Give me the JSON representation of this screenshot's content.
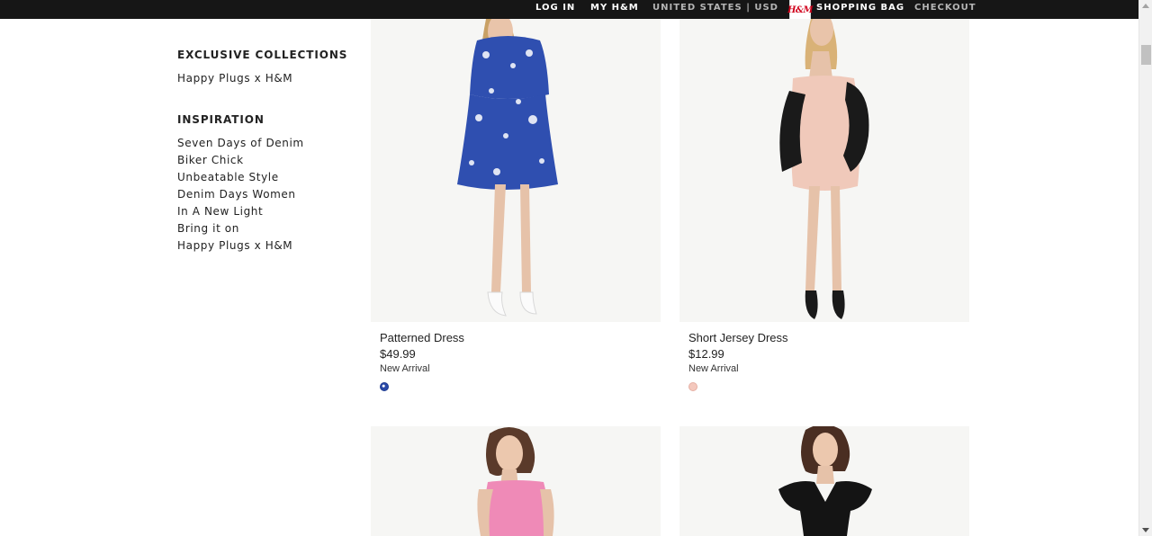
{
  "topnav": {
    "login": "LOG IN",
    "my_hm": "MY H&M",
    "country": "UNITED STATES | USD",
    "bag_logo": "H&M",
    "shopping_bag": "SHOPPING BAG",
    "checkout": "CHECKOUT"
  },
  "sidebar": {
    "exclusive_heading": "EXCLUSIVE COLLECTIONS",
    "exclusive_items": [
      "Happy Plugs x H&M"
    ],
    "inspiration_heading": "INSPIRATION",
    "inspiration_items": [
      "Seven Days of Denim",
      "Biker Chick",
      "Unbeatable Style",
      "Denim Days Women",
      "In A New Light",
      "Bring it on",
      "Happy Plugs x H&M"
    ]
  },
  "products": [
    {
      "name": "Patterned Dress",
      "price": "$49.99",
      "badge": "New Arrival",
      "swatch_color": "#2a49a8"
    },
    {
      "name": "Short Jersey Dress",
      "price": "$12.99",
      "badge": "New Arrival",
      "swatch_color": "#f4c8bd"
    }
  ],
  "colors": {
    "topbar_bg": "#161616",
    "image_bg": "#f6f6f4",
    "text": "#222222"
  }
}
